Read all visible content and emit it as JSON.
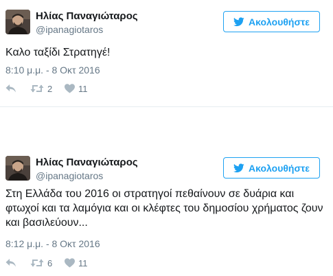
{
  "tweets": [
    {
      "name": "Ηλίας Παναγιώταρος",
      "handle": "@ipanagiotaros",
      "follow_label": "Ακολουθήστε",
      "text": "Καλο ταξίδι Στρατηγέ!",
      "time": "8:10 μ.μ. - 8 Οκτ 2016",
      "retweets": "2",
      "likes": "11"
    },
    {
      "name": "Ηλίας Παναγιώταρος",
      "handle": "@ipanagiotaros",
      "follow_label": "Ακολουθήστε",
      "text": "Στη Ελλάδα του 2016 οι στρατηγοί πεθαίνουν σε δυάρια και φτωχοί και τα λαμόγια και οι κλέφτες του δημοσίου χρήματος ζουν και βασιλεύουν...",
      "time": "8:12 μ.μ. - 8 Οκτ 2016",
      "retweets": "6",
      "likes": "11"
    }
  ],
  "icons": {
    "follow": "twitter-bird-icon",
    "reply": "reply-icon",
    "retweet": "retweet-icon",
    "like": "heart-icon"
  },
  "colors": {
    "accent": "#1da1f2",
    "text": "#14171a",
    "muted": "#657786",
    "icon": "#aab8c2",
    "divider": "#e6ecf0"
  }
}
